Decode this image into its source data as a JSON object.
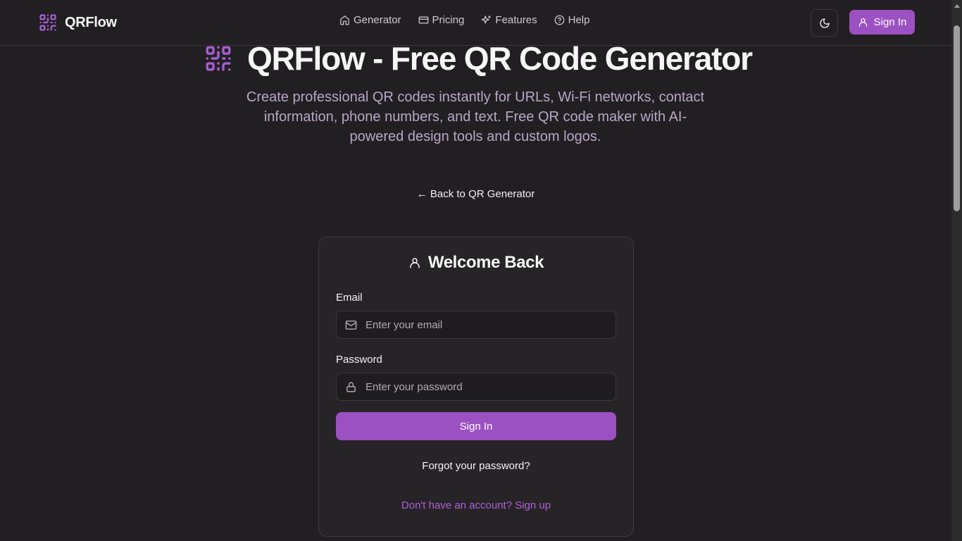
{
  "nav": {
    "brand": "QRFlow",
    "links": [
      {
        "label": "Generator",
        "icon": "home-icon"
      },
      {
        "label": "Pricing",
        "icon": "credit-card-icon"
      },
      {
        "label": "Features",
        "icon": "sparkles-icon"
      },
      {
        "label": "Help",
        "icon": "help-circle-icon"
      }
    ],
    "theme_icon": "moon-icon",
    "signin_label": "Sign In"
  },
  "hero": {
    "title": "QRFlow - Free QR Code Generator",
    "subtitle": "Create professional QR codes instantly for URLs, Wi-Fi networks, contact information, phone numbers, and text. Free QR code maker with AI-powered design tools and custom logos."
  },
  "back_link": "← Back to QR Generator",
  "login": {
    "title": "Welcome Back",
    "email_label": "Email",
    "email_placeholder": "Enter your email",
    "password_label": "Password",
    "password_placeholder": "Enter your password",
    "submit_label": "Sign In",
    "forgot_label": "Forgot your password?",
    "signup_label": "Don't have an account? Sign up"
  },
  "colors": {
    "background": "#221f22",
    "accent": "#9b51c1",
    "link": "#b05fd8",
    "subtitle": "#b8a7c7"
  }
}
